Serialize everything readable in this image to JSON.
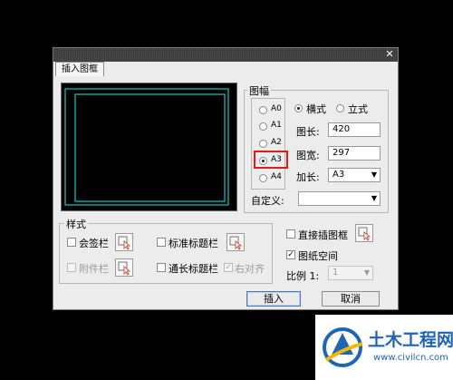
{
  "dialog": {
    "tab": "插入图框",
    "close_glyph": "✕",
    "size_group": {
      "title": "图幅",
      "sizes": [
        "A0",
        "A1",
        "A2",
        "A3",
        "A4"
      ],
      "selected": "A3",
      "orient_landscape": "横式",
      "orient_portrait": "立式",
      "length_label": "图长:",
      "length_value": "420",
      "width_label": "图宽:",
      "width_value": "297",
      "extend_label": "加长:",
      "extend_value": "A3",
      "custom_label": "自定义:",
      "custom_value": ""
    },
    "style_group": {
      "title": "样式",
      "sign_bar": "会签栏",
      "title_block": "标准标题栏",
      "attachment_bar": "附件栏",
      "long_title_block": "通长标题栏",
      "align_right": "右对齐"
    },
    "direct_insert": "直接插图框",
    "paper_space": "图纸空间",
    "scale_label": "比例 1:",
    "scale_value": "1",
    "insert_button": "插入",
    "cancel_button": "取消"
  },
  "watermark": {
    "brand": "土木工程网",
    "url": "www.civilcn.com"
  },
  "colors": {
    "preview_frame": "#18c8c0",
    "highlight": "#e01b1b",
    "brand_blue": "#1f64b6"
  }
}
